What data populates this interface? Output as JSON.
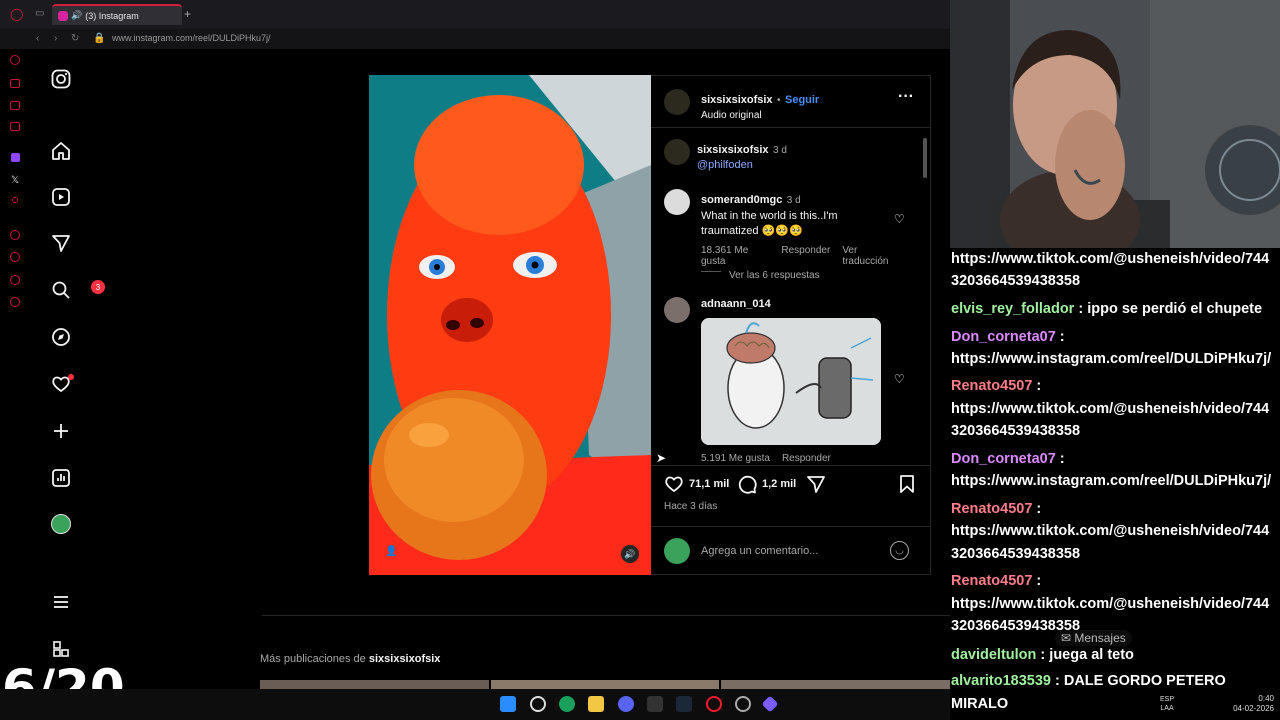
{
  "browser": {
    "tab_title": "(3) Instagram",
    "new_tab": "+",
    "url": "www.instagram.com/reel/DULDiPHku7j/"
  },
  "instagram_nav": {
    "items": [
      "instagram-logo-icon",
      "home-icon",
      "reels-icon",
      "messages-icon",
      "search-icon",
      "explore-icon",
      "notifications-icon",
      "create-icon",
      "dashboard-icon",
      "profile-icon",
      "more-icon",
      "also-from-meta-icon"
    ],
    "message_badge": "3"
  },
  "post": {
    "author": "sixsixsixofsix",
    "separator": "•",
    "follow_label": "Seguir",
    "audio": "Audio original",
    "caption_author": "sixsixsixofsix",
    "caption_time": "3 d",
    "caption_mention": "@philfoden",
    "comments": [
      {
        "user": "somerand0mgc",
        "time": "3 d",
        "text": "What in the world is this..I'm traumatized",
        "emoji": "🥺🥺🥺",
        "likes": "18.361 Me gusta",
        "reply": "Responder",
        "translate": "Ver traducción",
        "view_replies": "Ver las 6 respuestas"
      },
      {
        "user": "adnaann_014",
        "likes": "5.191 Me gusta",
        "reply": "Responder"
      }
    ],
    "like_count": "71,1 mil",
    "comment_count": "1,2 mil",
    "posted": "Hace 3 días",
    "comment_placeholder": "Agrega un comentario...",
    "more_from_prefix": "Más publicaciones de",
    "more_from_user": "sixsixsixofsix"
  },
  "overlay": {
    "counter": "6/20"
  },
  "chat": [
    {
      "name": "",
      "text": "https://www.tiktok.com/@usheneish/video/744"
    },
    {
      "name": "",
      "text": "3203664539438358"
    },
    {
      "name": "elvis_rey_follador",
      "text": " : ippo se perdió el chupete"
    },
    {
      "name": "Don_corneta07",
      "text": " :"
    },
    {
      "name": "",
      "text": "https://www.instagram.com/reel/DULDiPHku7j/"
    },
    {
      "name": "Renato4507",
      "text": " :"
    },
    {
      "name": "",
      "text": "https://www.tiktok.com/@usheneish/video/744"
    },
    {
      "name": "",
      "text": "3203664539438358"
    },
    {
      "name": "Don_corneta07",
      "text": " :"
    },
    {
      "name": "",
      "text": "https://www.instagram.com/reel/DULDiPHku7j/"
    },
    {
      "name": "Renato4507",
      "text": " :"
    },
    {
      "name": "",
      "text": "https://www.tiktok.com/@usheneish/video/744"
    },
    {
      "name": "",
      "text": "3203664539438358"
    },
    {
      "name": "Renato4507",
      "text": " :"
    },
    {
      "name": "",
      "text": "https://www.tiktok.com/@usheneish/video/744"
    },
    {
      "name": "",
      "text": "3203664539438358"
    },
    {
      "name": "davideltulon",
      "text": " : juega al teto"
    },
    {
      "name": "alvarito183539",
      "text": " : DALE GORDO PETERO"
    },
    {
      "name": "",
      "text": "MIRALO"
    }
  ],
  "messages_label": "Mensajes",
  "taskbar": {
    "lang": "ESP",
    "lang2": "LAA",
    "time": "0:40",
    "date": "04-02-2026"
  }
}
